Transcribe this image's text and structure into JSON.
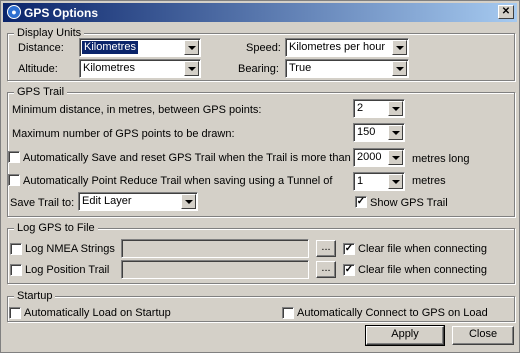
{
  "window": {
    "title": "GPS Options",
    "close_glyph": "✕"
  },
  "display_units": {
    "legend": "Display Units",
    "distance_label": "Distance:",
    "distance_value": "Kilometres",
    "altitude_label": "Altitude:",
    "altitude_value": "Kilometres",
    "speed_label": "Speed:",
    "speed_value": "Kilometres per hour",
    "bearing_label": "Bearing:",
    "bearing_value": "True"
  },
  "gps_trail": {
    "legend": "GPS Trail",
    "min_distance_label": "Minimum distance, in metres, between GPS points:",
    "min_distance_value": "2",
    "max_points_label": "Maximum number of GPS points to be drawn:",
    "max_points_value": "150",
    "auto_save_label": "Automatically Save and reset  GPS Trail when the Trail is more than",
    "auto_save_checked": false,
    "auto_save_value": "2000",
    "auto_save_suffix": "metres long",
    "auto_reduce_label": "Automatically Point Reduce Trail when saving using a Tunnel of",
    "auto_reduce_checked": false,
    "auto_reduce_value": "1",
    "auto_reduce_suffix": "metres",
    "save_trail_label": "Save Trail to:",
    "save_trail_value": "Edit Layer",
    "show_trail_label": "Show GPS Trail",
    "show_trail_checked": true
  },
  "log_gps": {
    "legend": "Log GPS to File",
    "nmea_label": "Log NMEA Strings",
    "nmea_checked": false,
    "nmea_browse": "...",
    "nmea_clear_label": "Clear file when connecting",
    "nmea_clear_checked": true,
    "position_label": "Log Position Trail",
    "position_checked": false,
    "position_browse": "...",
    "position_clear_label": "Clear file when connecting",
    "position_clear_checked": true
  },
  "startup": {
    "legend": "Startup",
    "auto_load_label": "Automatically Load on Startup",
    "auto_load_checked": false,
    "auto_connect_label": "Automatically Connect to GPS on Load",
    "auto_connect_checked": false
  },
  "buttons": {
    "apply": "Apply",
    "close": "Close"
  },
  "check_glyph": "✓"
}
